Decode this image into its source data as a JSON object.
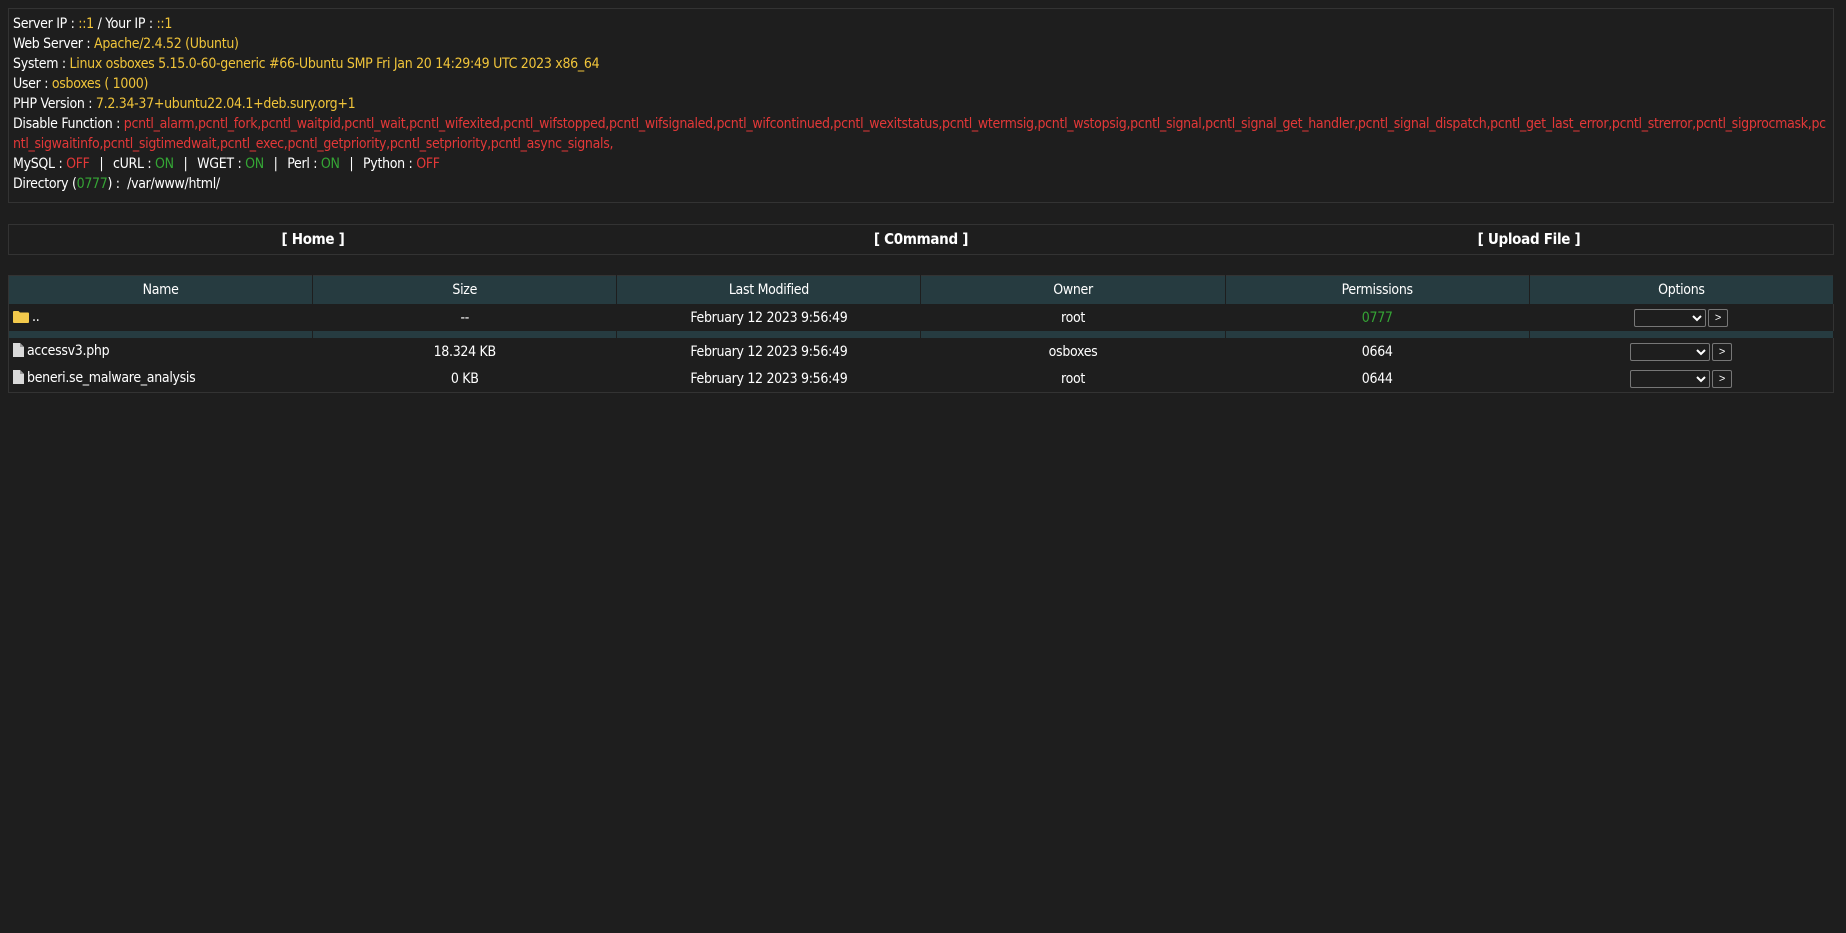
{
  "server": {
    "server_ip_label": "Server IP :",
    "server_ip": "::1",
    "divider": "/",
    "your_ip_label": "Your IP :",
    "your_ip": "::1",
    "web_server_label": "Web Server :",
    "web_server": "Apache/2.4.52 (Ubuntu)",
    "system_label": "System :",
    "system": "Linux osboxes 5.15.0-60-generic #66-Ubuntu SMP Fri Jan 20 14:29:49 UTC 2023 x86_64",
    "user_label": "User :",
    "user": "osboxes ( 1000)",
    "php_label": "PHP Version :",
    "php_version": "7.2.34-37+ubuntu22.04.1+deb.sury.org+1",
    "disable_label": "Disable Function :",
    "disable_functions": "pcntl_alarm,pcntl_fork,pcntl_waitpid,pcntl_wait,pcntl_wifexited,pcntl_wifstopped,pcntl_wifsignaled,pcntl_wifcontinued,pcntl_wexitstatus,pcntl_wtermsig,pcntl_wstopsig,pcntl_signal,pcntl_signal_get_handler,pcntl_signal_dispatch,pcntl_get_last_error,pcntl_strerror,pcntl_sigprocmask,pcntl_sigwaitinfo,pcntl_sigtimedwait,pcntl_exec,pcntl_getpriority,pcntl_setpriority,pcntl_async_signals,",
    "mysql_label": "MySQL :",
    "mysql": "OFF",
    "curl_label": "cURL :",
    "curl": "ON",
    "wget_label": "WGET :",
    "wget": "ON",
    "perl_label": "Perl :",
    "perl": "ON",
    "python_label": "Python :",
    "python": "OFF",
    "pipe": "|",
    "dir_label": "Directory (",
    "dir_perm": "0777",
    "dir_close": ") :",
    "dir_path": "/var/www/html/"
  },
  "nav": {
    "home": "[ Home ]",
    "command": "[ C0mmand ]",
    "upload": "[ Upload File ]"
  },
  "table": {
    "headers": {
      "name": "Name",
      "size": "Size",
      "modified": "Last Modified",
      "owner": "Owner",
      "permissions": "Permissions",
      "options": "Options"
    },
    "parent": {
      "name": "..",
      "size": "--",
      "modified": "February 12 2023 9:56:49",
      "owner": "root",
      "perms": "0777"
    },
    "files": [
      {
        "name": "accessv3.php",
        "size": "18.324 KB",
        "modified": "February 12 2023 9:56:49",
        "owner": "osboxes",
        "perms": "0664"
      },
      {
        "name": "beneri.se_malware_analysis",
        "size": "0 KB",
        "modified": "February 12 2023 9:56:49",
        "owner": "root",
        "perms": "0644"
      }
    ],
    "go_label": ">"
  },
  "colors": {
    "background": "#1e1e1e",
    "header_bg": "#263b40",
    "value_yellow": "#f0c43a",
    "value_red": "#e23838",
    "value_green": "#35a535"
  },
  "icons": {
    "folder": "folder-icon",
    "file": "file-icon"
  }
}
